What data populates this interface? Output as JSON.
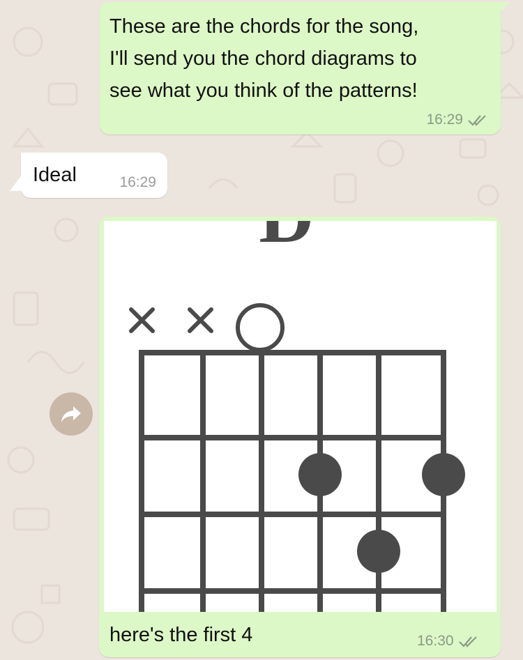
{
  "messages": [
    {
      "text": "These are the chords for the song, I'll send you the chord diagrams to see what you think of the patterns!",
      "lines": [
        "These are the chords for the song,",
        "I'll send you the chord diagrams to",
        "see what you think of the patterns!"
      ],
      "time": "16:29",
      "direction": "outgoing"
    },
    {
      "text": "Ideal",
      "time": "16:29",
      "direction": "incoming"
    },
    {
      "type": "image",
      "caption": "here's the first 4",
      "time": "16:30",
      "direction": "outgoing",
      "image": {
        "chord_name": "D",
        "string_markers": [
          "x",
          "x",
          "o",
          "",
          "",
          ""
        ],
        "fingers": [
          {
            "string": 4,
            "fret": 2
          },
          {
            "string": 6,
            "fret": 2
          },
          {
            "string": 5,
            "fret": 3
          }
        ]
      }
    }
  ],
  "icons": {
    "forward": "forward-arrow-icon",
    "read_receipt": "double-check-icon"
  },
  "colors": {
    "background": "#ece5dd",
    "outgoing_bubble": "#dcf8c6",
    "incoming_bubble": "#ffffff",
    "diagram_ink": "#4a4a4a"
  }
}
